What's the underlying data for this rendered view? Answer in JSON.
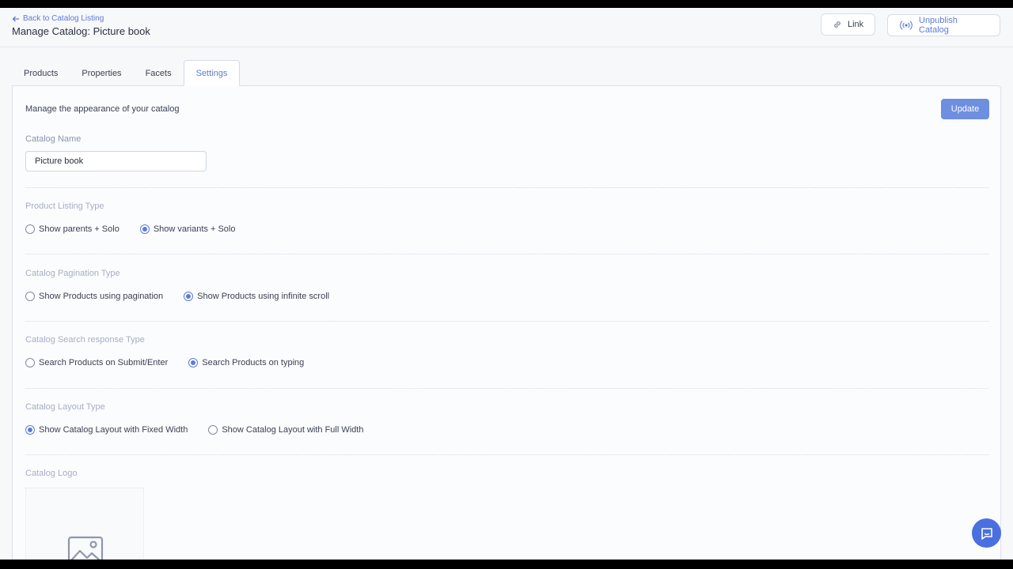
{
  "header": {
    "back_label": "Back to Catalog Listing",
    "title": "Manage Catalog: Picture book",
    "link_label": "Link",
    "unpublish_label": "Unpublish Catalog"
  },
  "tabs": [
    {
      "label": "Products"
    },
    {
      "label": "Properties"
    },
    {
      "label": "Facets"
    },
    {
      "label": "Settings",
      "active": true
    }
  ],
  "panel": {
    "description": "Manage the appearance of your catalog",
    "update_label": "Update"
  },
  "catalog_name": {
    "label": "Catalog Name",
    "value": "Picture book"
  },
  "sections": [
    {
      "label": "Product Listing Type",
      "options": [
        {
          "label": "Show parents + Solo",
          "checked": false
        },
        {
          "label": "Show variants + Solo",
          "checked": true
        }
      ]
    },
    {
      "label": "Catalog Pagination Type",
      "options": [
        {
          "label": "Show Products using pagination",
          "checked": false
        },
        {
          "label": "Show Products using infinite scroll",
          "checked": true
        }
      ]
    },
    {
      "label": "Catalog Search response Type",
      "options": [
        {
          "label": "Search Products on Submit/Enter",
          "checked": false
        },
        {
          "label": "Search Products on typing",
          "checked": true
        }
      ]
    },
    {
      "label": "Catalog Layout Type",
      "options": [
        {
          "label": "Show Catalog Layout with Fixed Width",
          "checked": true
        },
        {
          "label": "Show Catalog Layout with Full Width",
          "checked": false
        }
      ]
    }
  ],
  "logo": {
    "label": "Catalog Logo",
    "icon": "image-placeholder-icon"
  },
  "colors": {
    "accent": "#5d7bd6",
    "update_button": "#6e8ee0",
    "chat_button": "#4a6fe0"
  },
  "icons": {
    "back": "arrow-left-icon",
    "link": "link-icon",
    "unpublish": "broadcast-icon",
    "chat": "chat-icon"
  }
}
